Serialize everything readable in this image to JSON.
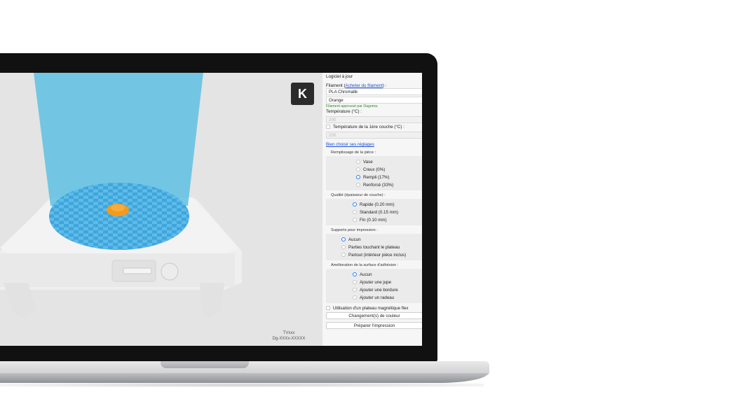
{
  "viewport": {
    "logo_icon": "dagoma-k-logo",
    "version_line1": "TVxxx",
    "version_line2": "Dg-XXXx-XXXXX"
  },
  "panel": {
    "status": "Logiciel à jour",
    "filament_label": "Filament  (",
    "filament_link": "Acheter du filament",
    "filament_label_end": ") :",
    "filament_value": "PLA Chromatik",
    "color_value": "Orange",
    "approved_text": "Filament approuvé par Dagoma.",
    "temperature_label": "Température (°C) :",
    "temperature_value": "200",
    "first_layer_label": "Température de la 1ère couche  (°C) :",
    "first_layer_value": "200",
    "settings_link": "Bien choisir ses réglages",
    "infill": {
      "title": "Remplissage de la pièce :",
      "options": [
        "Vase",
        "Creux (0%)",
        "Rempli (17%)",
        "Renforcé (33%)"
      ],
      "selected": 2
    },
    "quality": {
      "title": "Qualité (épaisseur de couche) :",
      "options": [
        "Rapide (0.20 mm)",
        "Standard (0.15 mm)",
        "Fin (0.10 mm)"
      ],
      "selected": 0
    },
    "supports": {
      "title": "Supports pour impression :",
      "options": [
        "Aucun",
        "Parties touchant le plateau",
        "Partout (intérieur pièce inclus)"
      ],
      "selected": 0
    },
    "adhesion": {
      "title": "Amélioration de la surface d'adhésion :",
      "options": [
        "Aucun",
        "Ajouter une jupe",
        "Ajouter une bordure",
        "Ajouter un radeau"
      ],
      "selected": 0
    },
    "flex_plate_label": "Utilisation d'un plateau magnétique flex",
    "color_change_button": "Changement(s) de couleur",
    "prepare_button": "Préparer l'impression"
  },
  "colors": {
    "accent": "#2a7ef0",
    "build_volume": "#4fb6d9",
    "plate": "#3fa8dc",
    "model": "#f39a1e"
  }
}
